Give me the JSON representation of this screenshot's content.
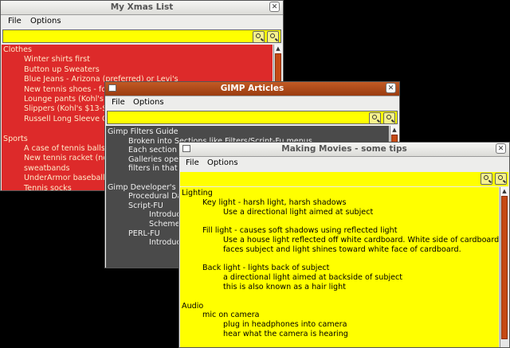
{
  "windows": {
    "xmas": {
      "title": "My Xmas List",
      "menu": {
        "file": "File",
        "options": "Options"
      },
      "lines": [
        {
          "text": "Clothes",
          "indent": 0
        },
        {
          "text": "Winter shirts first",
          "indent": 1
        },
        {
          "text": "Button up Sweaters",
          "indent": 1
        },
        {
          "text": "Blue Jeans - Arizona (preferred) or Levi's",
          "indent": 1
        },
        {
          "text": "New tennis shoes - fo",
          "indent": 1
        },
        {
          "text": "Lounge pants (Kohl's",
          "indent": 1
        },
        {
          "text": "Slippers (Kohl's $13-$",
          "indent": 1
        },
        {
          "text": "Russell Long Sleeve C",
          "indent": 1
        },
        {
          "text": "",
          "indent": 0
        },
        {
          "text": "Sports",
          "indent": 0
        },
        {
          "text": "A case of tennis balls",
          "indent": 1
        },
        {
          "text": "New tennis racket (no",
          "indent": 1
        },
        {
          "text": "sweatbands",
          "indent": 1
        },
        {
          "text": "UnderArmor baseball",
          "indent": 1
        },
        {
          "text": "Tennis socks",
          "indent": 1
        }
      ],
      "colors": {
        "bg": "#dd2a2a",
        "text": "#ffe9c8"
      }
    },
    "gimp": {
      "title": "GIMP Articles",
      "menu": {
        "file": "File",
        "options": "Options"
      },
      "lines": [
        {
          "text": "Gimp Filters Guide",
          "indent": 0
        },
        {
          "text": "Broken into Sections like Filters/Script-Fu menus",
          "indent": 1
        },
        {
          "text": "Each section b",
          "indent": 1
        },
        {
          "text": "Galleries oper",
          "indent": 1
        },
        {
          "text": "filters in that s",
          "indent": 1
        },
        {
          "text": "",
          "indent": 0
        },
        {
          "text": "Gimp Developer's G",
          "indent": 0
        },
        {
          "text": "Procedural Da",
          "indent": 1
        },
        {
          "text": "Script-FU",
          "indent": 1
        },
        {
          "text": "Introduc",
          "indent": 2
        },
        {
          "text": "Scheme",
          "indent": 2
        },
        {
          "text": "PERL-FU",
          "indent": 1
        },
        {
          "text": "Introduc",
          "indent": 2
        }
      ],
      "colors": {
        "bg": "#4a4a4a",
        "text": "#f0f0f0"
      }
    },
    "movies": {
      "title": "Making Movies - some tips",
      "menu": {
        "file": "File",
        "options": "Options"
      },
      "lines": [
        {
          "text": "Lighting",
          "indent": 0
        },
        {
          "text": "Key light - harsh light, harsh shadows",
          "indent": 1
        },
        {
          "text": "Use a directional light aimed at subject",
          "indent": 2
        },
        {
          "text": "",
          "indent": 0
        },
        {
          "text": "Fill light - causes soft shadows using reflected light",
          "indent": 1
        },
        {
          "text": "Use a house light reflected off white cardboard.  White side of cardboard",
          "indent": 2
        },
        {
          "text": "faces subject and light shines toward white face of cardboard.",
          "indent": 2
        },
        {
          "text": "",
          "indent": 0
        },
        {
          "text": "Back light - lights back of subject",
          "indent": 1
        },
        {
          "text": "a directional light aimed at backside of subject",
          "indent": 2
        },
        {
          "text": "this is also known as a hair light",
          "indent": 2
        },
        {
          "text": "",
          "indent": 0
        },
        {
          "text": "Audio",
          "indent": 0
        },
        {
          "text": "mic on camera",
          "indent": 1
        },
        {
          "text": "plug in headphones into camera",
          "indent": 2
        },
        {
          "text": "hear what the camera is hearing",
          "indent": 2
        }
      ],
      "colors": {
        "bg": "#ffff00",
        "text": "#000000"
      }
    }
  },
  "icons": {
    "close": "close-icon",
    "search": "search-icon",
    "zoom": "zoom-icon",
    "window": "window-icon"
  }
}
